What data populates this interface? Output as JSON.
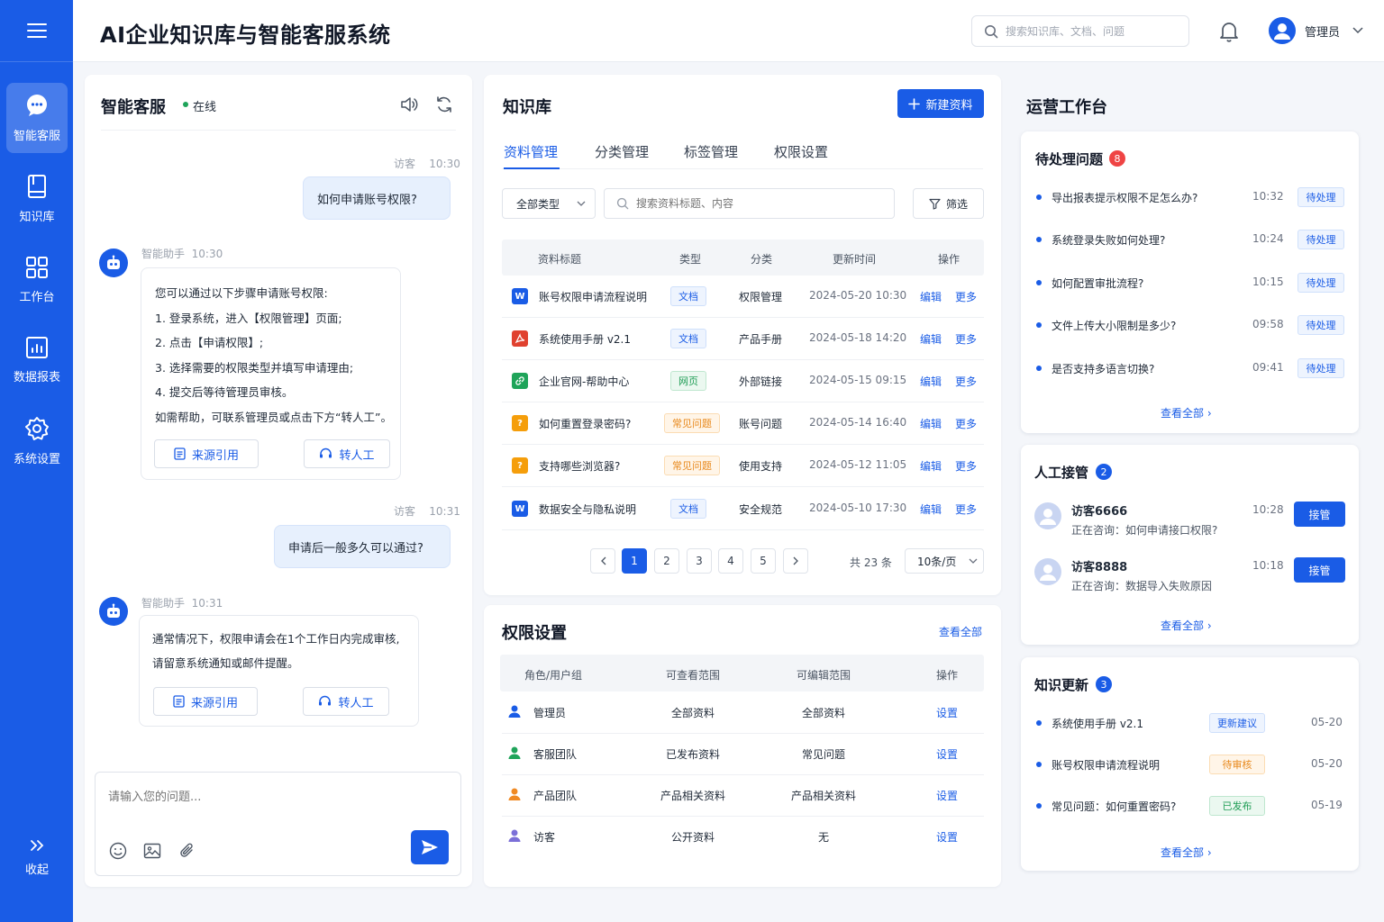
{
  "app": {
    "title": "AI企业知识库与智能客服系统"
  },
  "header": {
    "search_placeholder": "搜索知识库、文档、问题",
    "user_name": "管理员"
  },
  "sidebar": {
    "items": [
      {
        "label": "智能客服",
        "icon": "chat-icon"
      },
      {
        "label": "知识库",
        "icon": "book-icon"
      },
      {
        "label": "工作台",
        "icon": "grid-icon"
      },
      {
        "label": "数据报表",
        "icon": "report-icon"
      },
      {
        "label": "系统设置",
        "icon": "gear-icon"
      }
    ],
    "collapse_label": "收起"
  },
  "chat": {
    "title": "智能客服",
    "status": "在线",
    "messages": [
      {
        "role": "visitor",
        "sender": "访客",
        "time": "10:30",
        "text": "如何申请账号权限?"
      },
      {
        "role": "assistant",
        "sender": "智能助手",
        "time": "10:30",
        "lines": [
          "您可以通过以下步骤申请账号权限:",
          "1. 登录系统，进入【权限管理】页面;",
          "2. 点击【申请权限】;",
          "3. 选择需要的权限类型并填写申请理由;",
          "4. 提交后等待管理员审核。",
          "如需帮助，可联系管理员或点击下方“转人工”。"
        ]
      },
      {
        "role": "visitor",
        "sender": "访客",
        "time": "10:31",
        "text": "申请后一般多久可以通过?"
      },
      {
        "role": "assistant",
        "sender": "智能助手",
        "time": "10:31",
        "lines": [
          "通常情况下，权限申请会在1个工作日内完成审核,",
          "请留意系统通知或邮件提醒。"
        ]
      }
    ],
    "source_label": "来源引用",
    "transfer_label": "转人工",
    "input_placeholder": "请输入您的问题..."
  },
  "kb": {
    "title": "知识库",
    "new_button": "新建资料",
    "tabs": [
      "资料管理",
      "分类管理",
      "标签管理",
      "权限设置"
    ],
    "type_filter": "全部类型",
    "search_placeholder": "搜索资料标题、内容",
    "filter_label": "筛选",
    "columns": [
      "资料标题",
      "类型",
      "分类",
      "更新时间",
      "操作"
    ],
    "rows": [
      {
        "icon": "word",
        "title": "账号权限申请流程说明",
        "type": "文档",
        "category": "权限管理",
        "updated": "2024-05-20 10:30"
      },
      {
        "icon": "pdf",
        "title": "系统使用手册 v2.1",
        "type": "文档",
        "category": "产品手册",
        "updated": "2024-05-18 14:20"
      },
      {
        "icon": "link",
        "title": "企业官网-帮助中心",
        "type": "网页",
        "category": "外部链接",
        "updated": "2024-05-15 09:15"
      },
      {
        "icon": "question",
        "title": "如何重置登录密码?",
        "type": "常见问题",
        "category": "账号问题",
        "updated": "2024-05-14 16:40"
      },
      {
        "icon": "question",
        "title": "支持哪些浏览器?",
        "type": "常见问题",
        "category": "使用支持",
        "updated": "2024-05-12 11:05"
      },
      {
        "icon": "word",
        "title": "数据安全与隐私说明",
        "type": "文档",
        "category": "安全规范",
        "updated": "2024-05-10 17:30"
      }
    ],
    "edit_label": "编辑",
    "more_label": "更多",
    "pages": [
      "1",
      "2",
      "3",
      "4",
      "5"
    ],
    "current_page": 1,
    "total": "共 23 条",
    "page_size": "10条/页"
  },
  "perm": {
    "title": "权限设置",
    "view_all": "查看全部",
    "columns": [
      "角色/用户组",
      "可查看范围",
      "可编辑范围",
      "操作"
    ],
    "rows": [
      {
        "role": "管理员",
        "view": "全部资料",
        "edit": "全部资料",
        "color": "#1a5ce6"
      },
      {
        "role": "客服团队",
        "view": "已发布资料",
        "edit": "常见问题",
        "color": "#1fa45a"
      },
      {
        "role": "产品团队",
        "view": "产品相关资料",
        "edit": "产品相关资料",
        "color": "#f08a24"
      },
      {
        "role": "访客",
        "view": "公开资料",
        "edit": "无",
        "color": "#7b6fd8"
      }
    ],
    "action_label": "设置"
  },
  "ops": {
    "title": "运营工作台",
    "pending": {
      "title": "待处理问题",
      "count": "8",
      "items": [
        {
          "text": "导出报表提示权限不足怎么办?",
          "time": "10:32",
          "status": "待处理"
        },
        {
          "text": "系统登录失败如何处理?",
          "time": "10:24",
          "status": "待处理"
        },
        {
          "text": "如何配置审批流程?",
          "time": "10:15",
          "status": "待处理"
        },
        {
          "text": "文件上传大小限制是多少?",
          "time": "09:58",
          "status": "待处理"
        },
        {
          "text": "是否支持多语言切换?",
          "time": "09:41",
          "status": "待处理"
        }
      ],
      "view_all": "查看全部"
    },
    "handoff": {
      "title": "人工接管",
      "count": "2",
      "items": [
        {
          "name": "访客6666",
          "desc": "正在咨询：如何申请接口权限?",
          "time": "10:28",
          "action": "接管"
        },
        {
          "name": "访客8888",
          "desc": "正在咨询：数据导入失败原因",
          "time": "10:18",
          "action": "接管"
        }
      ],
      "view_all": "查看全部"
    },
    "updates": {
      "title": "知识更新",
      "count": "3",
      "items": [
        {
          "text": "系统使用手册 v2.1",
          "status": "更新建议",
          "date": "05-20",
          "color": "#1a5ce6",
          "bg": "#eef4fe",
          "border": "#cfe0fb"
        },
        {
          "text": "账号权限申请流程说明",
          "status": "待审核",
          "date": "05-20",
          "color": "#e8891c",
          "bg": "#fff5e8",
          "border": "#fbdcb3"
        },
        {
          "text": "常见问题：如何重置密码?",
          "status": "已发布",
          "date": "05-19",
          "color": "#1f9d55",
          "bg": "#ebf8f0",
          "border": "#bfe7cf"
        }
      ],
      "view_all": "查看全部"
    }
  }
}
